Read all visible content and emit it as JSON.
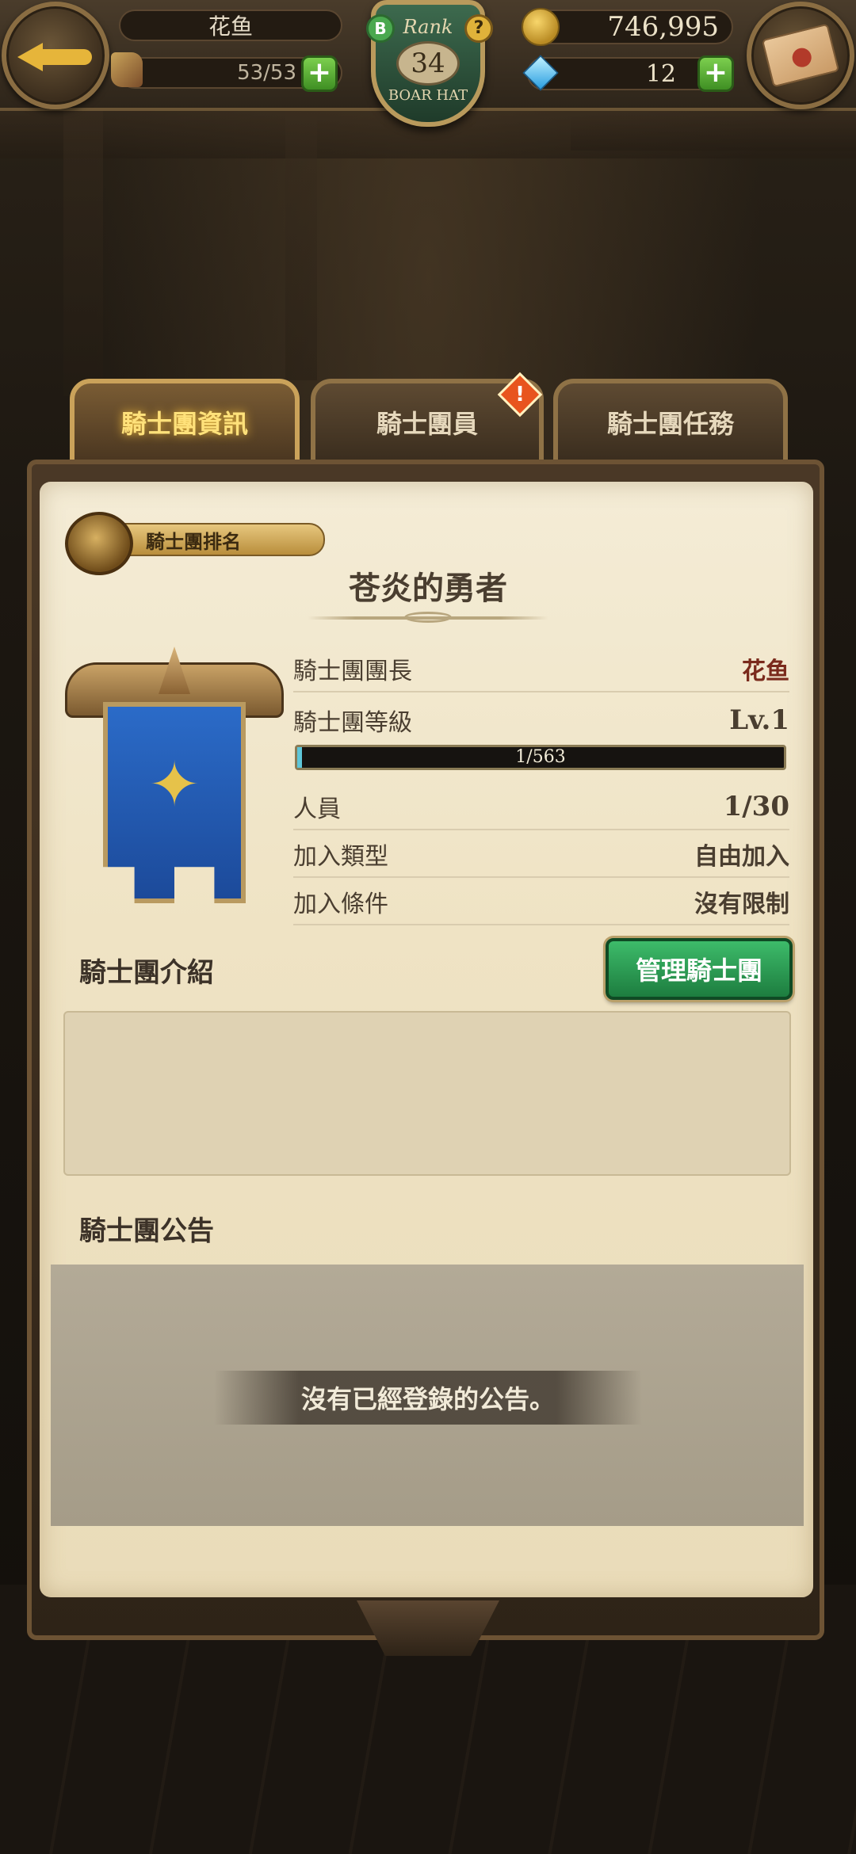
{
  "header": {
    "player_name": "花鱼",
    "stamina": "53/53",
    "rank_label": "Rank",
    "rank_level": "34",
    "rank_title": "BOAR HAT",
    "badge_b": "B",
    "badge_help": "?",
    "gold": "746,995",
    "gems": "12",
    "plus": "+",
    "icons": {
      "back": "back-arrow-icon",
      "mail": "mail-icon",
      "stamina": "boot-icon",
      "gold": "gold-coin-icon",
      "gem": "diamond-icon"
    }
  },
  "tabs": [
    {
      "label": "騎士團資訊",
      "active": true
    },
    {
      "label": "騎士團員",
      "active": false,
      "alert": "!"
    },
    {
      "label": "騎士團任務",
      "active": false
    }
  ],
  "guild": {
    "ranking_label": "騎士團排名",
    "name": "苍炎的勇者",
    "rows": [
      {
        "label": "騎士團團長",
        "value": "花鱼"
      },
      {
        "label": "騎士團等級",
        "value": "Lv.1"
      },
      {
        "label": "人員",
        "value": "1/30"
      },
      {
        "label": "加入類型",
        "value": "自由加入"
      },
      {
        "label": "加入條件",
        "value": "沒有限制"
      }
    ],
    "xp": {
      "text": "1/563",
      "current": 1,
      "max": 563
    }
  },
  "intro": {
    "title": "騎士團介紹",
    "manage_button": "管理騎士團",
    "text": ""
  },
  "notice": {
    "title": "騎士團公告",
    "empty_text": "沒有已經登錄的公告。"
  },
  "colors": {
    "accent_gold": "#e6b53a",
    "manage_green": "#2a9a52",
    "tab_active": "#ffe17a"
  }
}
